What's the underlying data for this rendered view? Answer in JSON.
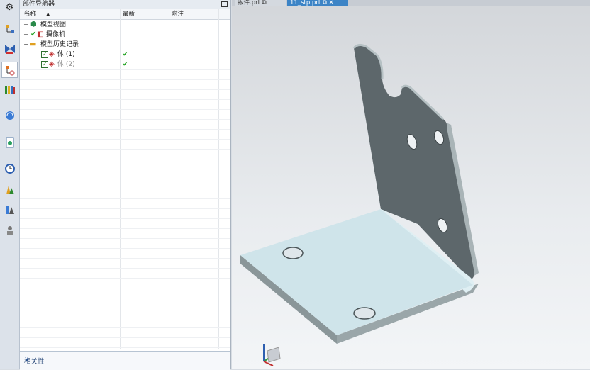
{
  "sidebar": {
    "icons": [
      "gear-icon",
      "assembly-navigator-icon",
      "constraint-navigator-icon",
      "part-navigator-icon",
      "reuse-library-icon",
      "web-browser-icon",
      "history-icon",
      "history-clock-icon",
      "system-materials-icon",
      "process-studio-icon",
      "roles-icon"
    ]
  },
  "navigator": {
    "title": "部件导航器",
    "columns": {
      "name": "名称",
      "latest": "最新",
      "comment": "附注"
    },
    "rows": [
      {
        "label": "模型视图",
        "expander": "+"
      },
      {
        "label": "摄像机",
        "expander": "+"
      },
      {
        "label": "模型历史记录",
        "expander": "−"
      },
      {
        "label": "体 (1)",
        "latest": "✔"
      },
      {
        "label": "体 (2)",
        "latest": "✔"
      }
    ],
    "relevance_label": "相关性"
  },
  "tabs": [
    {
      "label": "钣件.prt",
      "active": false
    },
    {
      "label": "11_stp.prt",
      "active": true
    }
  ],
  "colors": {
    "accent": "#3c84c6",
    "model_dark": "#5d676b",
    "model_light": "#cfe4ea",
    "check_green": "#1fa01f"
  }
}
